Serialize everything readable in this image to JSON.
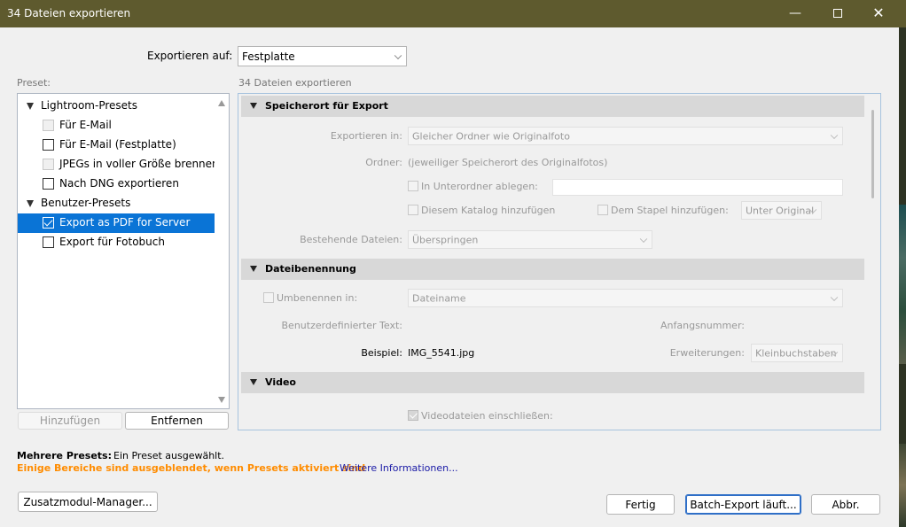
{
  "window": {
    "title": "34 Dateien exportieren",
    "controls": {
      "minimize": "—",
      "close": "✕"
    }
  },
  "export_to": {
    "label": "Exportieren auf:",
    "value": "Festplatte"
  },
  "preset": {
    "label": "Preset:",
    "groups": [
      {
        "name": "Lightroom-Presets",
        "items": [
          {
            "label": "Für E-Mail",
            "state": "disabled"
          },
          {
            "label": "Für E-Mail (Festplatte)",
            "state": "unchecked"
          },
          {
            "label": "JPEGs in voller Größe brennen",
            "state": "disabled"
          },
          {
            "label": "Nach DNG exportieren",
            "state": "unchecked"
          }
        ]
      },
      {
        "name": "Benutzer-Presets",
        "items": [
          {
            "label": "Export as PDF for Server",
            "state": "checked",
            "selected": true
          },
          {
            "label": "Export für Fotobuch",
            "state": "unchecked"
          }
        ]
      }
    ],
    "add_label": "Hinzufügen",
    "remove_label": "Entfernen"
  },
  "settings": {
    "header": "34 Dateien exportieren",
    "sections": {
      "location": {
        "title": "Speicherort für Export",
        "export_in_label": "Exportieren in:",
        "export_in_value": "Gleicher Ordner wie Originalfoto",
        "folder_label": "Ordner:",
        "folder_value": "(jeweiliger Speicherort des Originalfotos)",
        "subfolder_label": "In Unterordner ablegen:",
        "catalog_label": "Diesem Katalog hinzufügen",
        "stack_label": "Dem Stapel hinzufügen:",
        "stack_value": "Unter Original",
        "existing_label": "Bestehende Dateien:",
        "existing_value": "Überspringen"
      },
      "naming": {
        "title": "Dateibenennung",
        "rename_label": "Umbenennen in:",
        "rename_value": "Dateiname",
        "custom_text_label": "Benutzerdefinierter Text:",
        "start_number_label": "Anfangsnummer:",
        "example_label": "Beispiel:",
        "example_value": "IMG_5541.jpg",
        "extensions_label": "Erweiterungen:",
        "extensions_value": "Kleinbuchstaben"
      },
      "video": {
        "title": "Video",
        "include_label": "Videodateien einschließen:"
      }
    }
  },
  "footer": {
    "multiple_presets_label": "Mehrere Presets:",
    "multiple_presets_value": "Ein Preset ausgewählt.",
    "warning": "Einige Bereiche sind ausgeblendet, wenn Presets aktiviert sind",
    "more_info": "Weitere Informationen...",
    "plugin_manager": "Zusatzmodul-Manager...",
    "done": "Fertig",
    "batch_export": "Batch-Export läuft...",
    "cancel": "Abbr."
  },
  "colors": {
    "titlebar": "#5e5a2e",
    "selection": "#0a74d6",
    "warning": "#ff8c00",
    "link": "#1a1aa6"
  }
}
